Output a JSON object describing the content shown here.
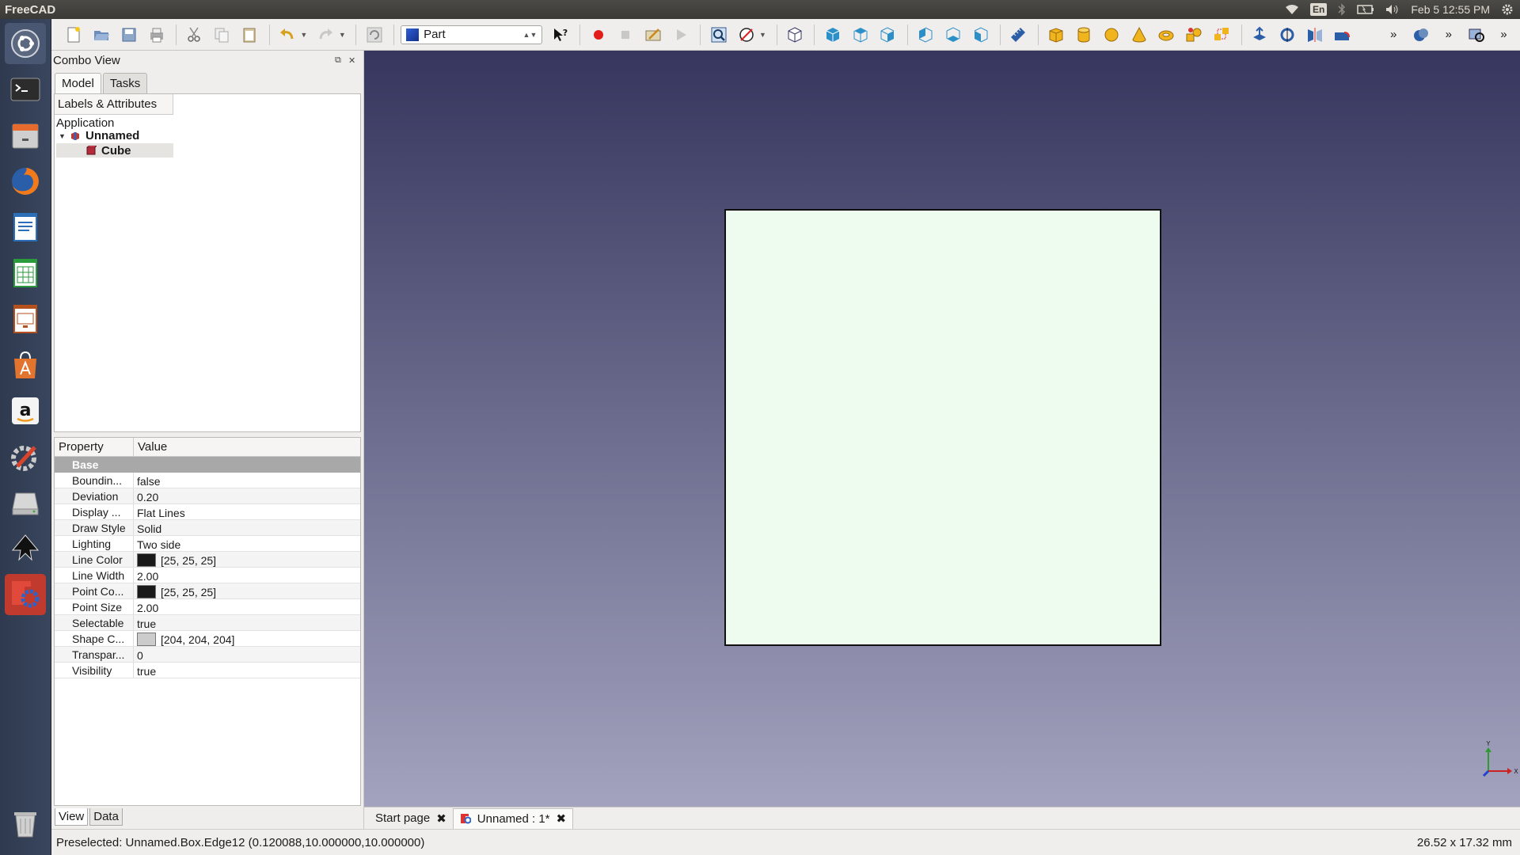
{
  "top_panel": {
    "app_title": "FreeCAD",
    "keyboard": "En",
    "clock": "Feb  5 12:55 PM"
  },
  "launcher": {
    "items": [
      "dash-home",
      "terminal",
      "files",
      "firefox",
      "writer",
      "calc",
      "impress",
      "software-center",
      "amazon",
      "system-settings",
      "disk",
      "inkscape",
      "freecad",
      "trash"
    ]
  },
  "toolbar": {
    "workbench": "Part"
  },
  "combo_view": {
    "title": "Combo View",
    "tabs": [
      "Model",
      "Tasks"
    ],
    "tree_header": "Labels & Attributes",
    "tree": {
      "root": "Application",
      "document": "Unnamed",
      "object": "Cube"
    },
    "properties": {
      "col_property": "Property",
      "col_value": "Value",
      "group": "Base",
      "rows": [
        {
          "key": "Boundin...",
          "value": "false"
        },
        {
          "key": "Deviation",
          "value": "0.20"
        },
        {
          "key": "Display ...",
          "value": "Flat Lines"
        },
        {
          "key": "Draw Style",
          "value": "Solid"
        },
        {
          "key": "Lighting",
          "value": "Two side"
        },
        {
          "key": "Line Color",
          "value": "[25, 25, 25]",
          "swatch": "#191919"
        },
        {
          "key": "Line Width",
          "value": "2.00"
        },
        {
          "key": "Point Co...",
          "value": "[25, 25, 25]",
          "swatch": "#191919"
        },
        {
          "key": "Point Size",
          "value": "2.00"
        },
        {
          "key": "Selectable",
          "value": "true"
        },
        {
          "key": "Shape C...",
          "value": "[204, 204, 204]",
          "swatch": "#cccccc"
        },
        {
          "key": "Transpar...",
          "value": "0"
        },
        {
          "key": "Visibility",
          "value": "true"
        }
      ]
    },
    "bottom_tabs": [
      "View",
      "Data"
    ]
  },
  "view3d": {
    "face_color": "#eefcef",
    "axis_y": "Y",
    "axis_x": "X"
  },
  "doc_tabs": [
    {
      "label": "Start page"
    },
    {
      "label": "Unnamed : 1*"
    }
  ],
  "status": {
    "message": "Preselected: Unnamed.Box.Edge12 (0.120088,10.000000,10.000000)",
    "dimensions": "26.52 x 17.32 mm"
  }
}
